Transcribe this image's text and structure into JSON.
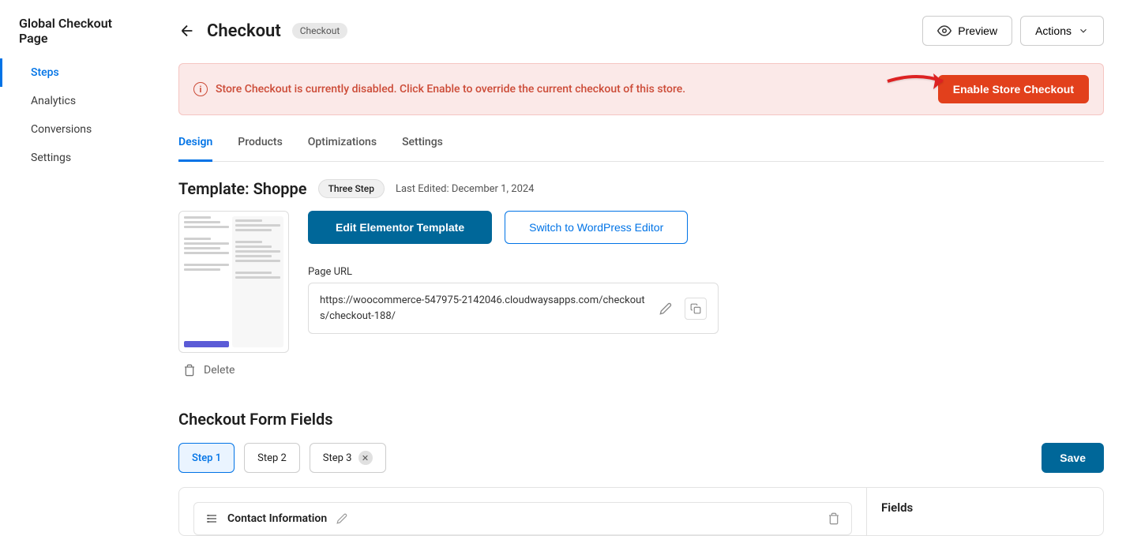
{
  "sidebar": {
    "title": "Global Checkout Page",
    "items": [
      {
        "label": "Steps",
        "active": true
      },
      {
        "label": "Analytics",
        "active": false
      },
      {
        "label": "Conversions",
        "active": false
      },
      {
        "label": "Settings",
        "active": false
      }
    ]
  },
  "header": {
    "title": "Checkout",
    "badge": "Checkout",
    "preview_label": "Preview",
    "actions_label": "Actions"
  },
  "alert": {
    "message": "Store Checkout is currently disabled. Click Enable to override the current checkout of this store.",
    "button": "Enable Store Checkout"
  },
  "tabs": [
    {
      "label": "Design",
      "active": true
    },
    {
      "label": "Products",
      "active": false
    },
    {
      "label": "Optimizations",
      "active": false
    },
    {
      "label": "Settings",
      "active": false
    }
  ],
  "template": {
    "title": "Template: Shoppe",
    "type_badge": "Three Step",
    "last_edited": "Last Edited: December 1, 2024",
    "edit_button": "Edit Elementor Template",
    "switch_button": "Switch to WordPress Editor",
    "url_label": "Page URL",
    "url": "https://woocommerce-547975-2142046.cloudwaysapps.com/checkouts/checkout-188/",
    "delete_label": "Delete"
  },
  "form": {
    "section_title": "Checkout Form Fields",
    "save_label": "Save",
    "steps": [
      {
        "label": "Step 1",
        "active": true,
        "closable": false
      },
      {
        "label": "Step 2",
        "active": false,
        "closable": false
      },
      {
        "label": "Step 3",
        "active": false,
        "closable": true
      }
    ],
    "group_title": "Contact Information",
    "sidebar_title": "Fields"
  }
}
